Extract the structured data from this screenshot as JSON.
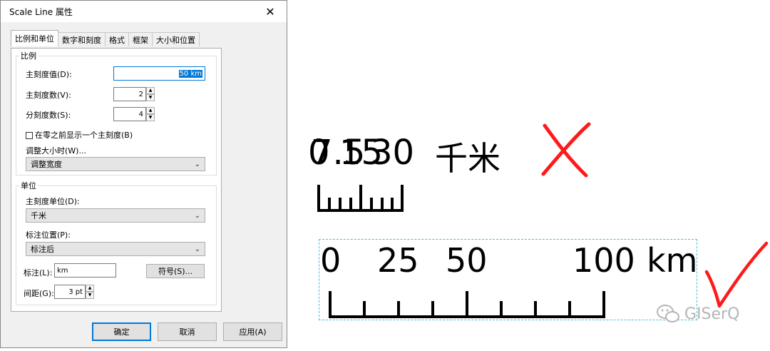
{
  "dialog": {
    "title": "Scale Line 属性",
    "tabs": [
      "比例和单位",
      "数字和刻度",
      "格式",
      "框架",
      "大小和位置"
    ],
    "scale_group": {
      "legend": "比例",
      "main_value_label": "主刻度值(D):",
      "main_value": "50 km",
      "main_count_label": "主刻度数(V):",
      "main_count": "2",
      "sub_count_label": "分刻度数(S):",
      "sub_count": "4",
      "show_before_zero_label": "在零之前显示一个主刻度(B)",
      "resize_label": "调整大小时(W)...",
      "resize_value": "调整宽度"
    },
    "unit_group": {
      "legend": "单位",
      "division_units_label": "主刻度单位(D):",
      "division_units_value": "千米",
      "label_position_label": "标注位置(P):",
      "label_position_value": "标注后",
      "label_label": "标注(L):",
      "label_value": "km",
      "symbol_button": "符号(S)...",
      "gap_label": "间距(G):",
      "gap_value": "3 pt"
    },
    "buttons": {
      "ok": "确定",
      "cancel": "取消",
      "apply": "应用(A)"
    }
  },
  "bad_example": {
    "label_overlap_a": "0",
    "label_overlap_b": "7.5",
    "label_overlap_c": "15",
    "label_overlap_d": "30",
    "label_unit": "千米"
  },
  "good_example": {
    "labels": [
      "0",
      "25",
      "50",
      "100"
    ],
    "unit": "km"
  },
  "marks": {
    "cross_color": "#ff1a1a",
    "check_color": "#ff1a1a"
  },
  "watermark": {
    "text": "GISerQ",
    "icon": "wechat-icon"
  }
}
